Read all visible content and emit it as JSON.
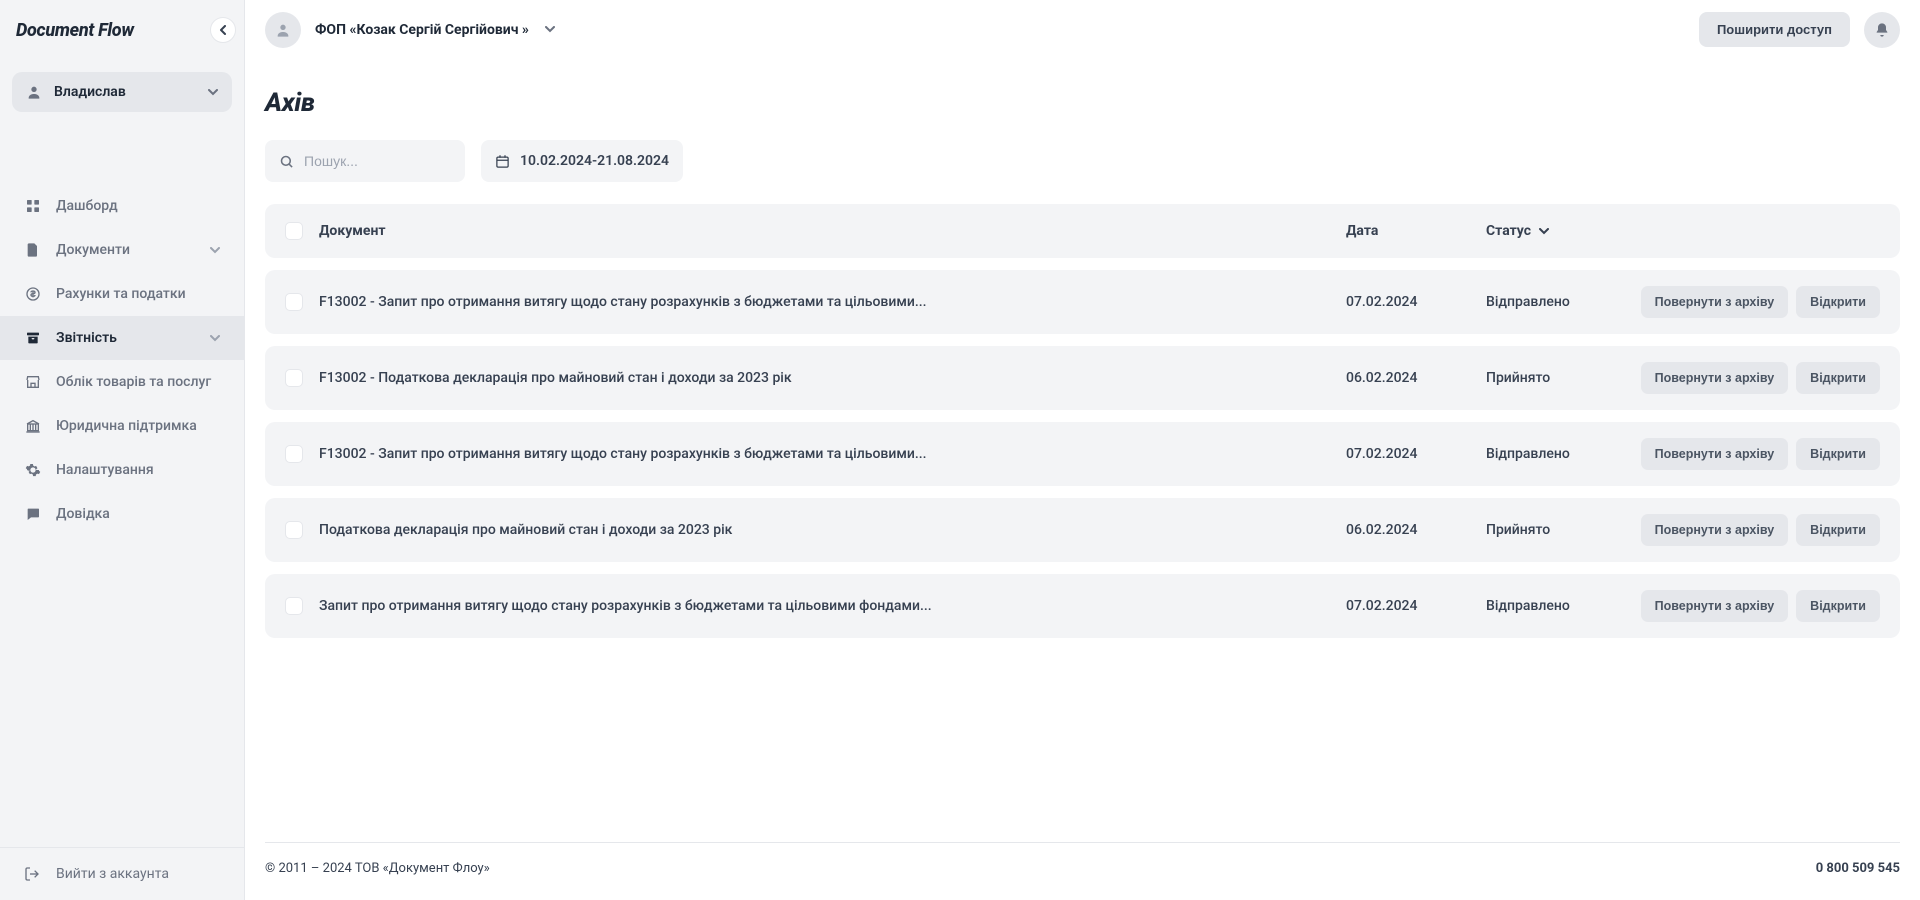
{
  "app": {
    "name": "Document Flow"
  },
  "user": {
    "name": "Владислав"
  },
  "nav": {
    "items": [
      {
        "label": "Дашборд",
        "icon": "grid-icon",
        "expandable": false
      },
      {
        "label": "Документи",
        "icon": "file-icon",
        "expandable": true
      },
      {
        "label": "Рахунки та податки",
        "icon": "dollar-icon",
        "expandable": false
      },
      {
        "label": "Звітність",
        "icon": "archive-icon",
        "expandable": true,
        "active": true
      },
      {
        "label": "Облік товарів та послуг",
        "icon": "storefront-icon",
        "expandable": false
      },
      {
        "label": "Юридична підтримка",
        "icon": "bank-icon",
        "expandable": false
      },
      {
        "label": "Налаштування",
        "icon": "gear-icon",
        "expandable": false
      },
      {
        "label": "Довідка",
        "icon": "chat-icon",
        "expandable": false
      }
    ],
    "logout": "Вийти з аккаунта"
  },
  "topbar": {
    "org": "ФОП «Козак Сергій Сергійович »",
    "share": "Поширити доступ"
  },
  "page": {
    "title": "Ахів",
    "search_placeholder": "Пошук...",
    "date_range": "10.02.2024-21.08.2024"
  },
  "table": {
    "headers": {
      "doc": "Документ",
      "date": "Дата",
      "status": "Статус"
    },
    "actions": {
      "restore": "Повернути з  архіву",
      "open": "Відкрити"
    },
    "rows": [
      {
        "doc": "F13002 - Запит про отримання витягу щодо стану розрахунків з бюджетами та цільовими...",
        "date": "07.02.2024",
        "status": "Відправлено"
      },
      {
        "doc": "F13002 - Податкова декларація про майновий стан і доходи за 2023 рік",
        "date": "06.02.2024",
        "status": "Прийнято"
      },
      {
        "doc": "F13002 - Запит про отримання витягу щодо стану розрахунків з бюджетами та цільовими...",
        "date": "07.02.2024",
        "status": "Відправлено"
      },
      {
        "doc": "Податкова декларація про майновий стан і доходи за 2023 рік",
        "date": "06.02.2024",
        "status": "Прийнято"
      },
      {
        "doc": "Запит про отримання витягу щодо стану розрахунків з бюджетами та цільовими фондами...",
        "date": "07.02.2024",
        "status": "Відправлено"
      }
    ]
  },
  "footer": {
    "copyright": "© 2011 – 2024 ТОВ «Документ Флоу»",
    "phone": "0 800 509 545"
  }
}
